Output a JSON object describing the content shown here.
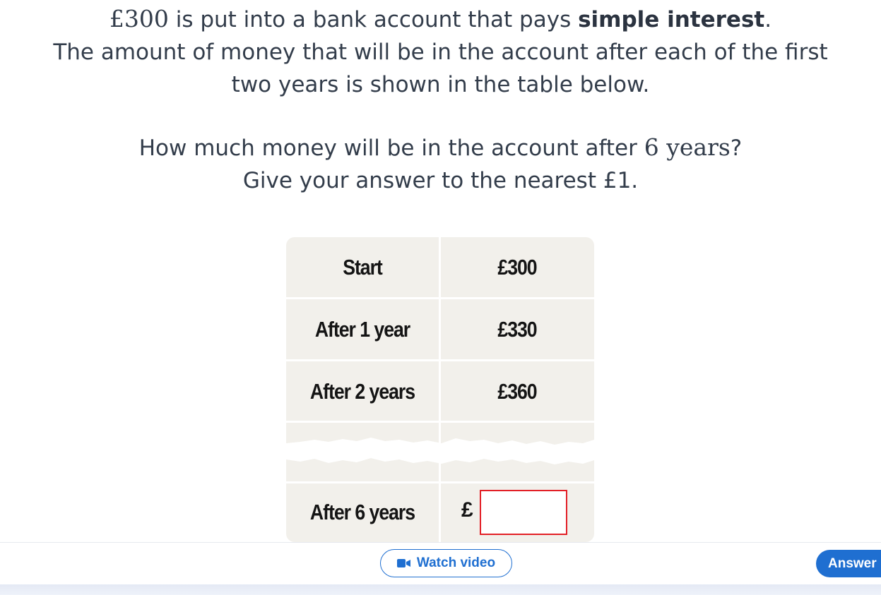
{
  "question": {
    "line1_amount": "£300",
    "line1_text": " is put into a bank account that pays ",
    "line1_bold": "simple interest",
    "line1_end": ".",
    "line2": "The amount of money that will be in the account after each of the first",
    "line3": "two years is shown in the table below.",
    "line4_text": "How much money will be in the account after ",
    "line4_math": "6 years",
    "line4_end": "?",
    "line5": "Give your answer to the nearest £1."
  },
  "table": {
    "rows": [
      {
        "label": "Start",
        "value": "£300"
      },
      {
        "label": "After 1 year",
        "value": "£330"
      },
      {
        "label": "After 2 years",
        "value": "£360"
      }
    ],
    "answer_row": {
      "label": "After 6 years",
      "currency": "£",
      "input_value": ""
    }
  },
  "actions": {
    "watch_video": "Watch video",
    "answer": "Answer"
  },
  "colors": {
    "accent": "#1f6fd1",
    "input_border": "#e21f26",
    "table_bg": "#f2f0eb"
  },
  "icons": {
    "video": "video-camera-icon"
  }
}
